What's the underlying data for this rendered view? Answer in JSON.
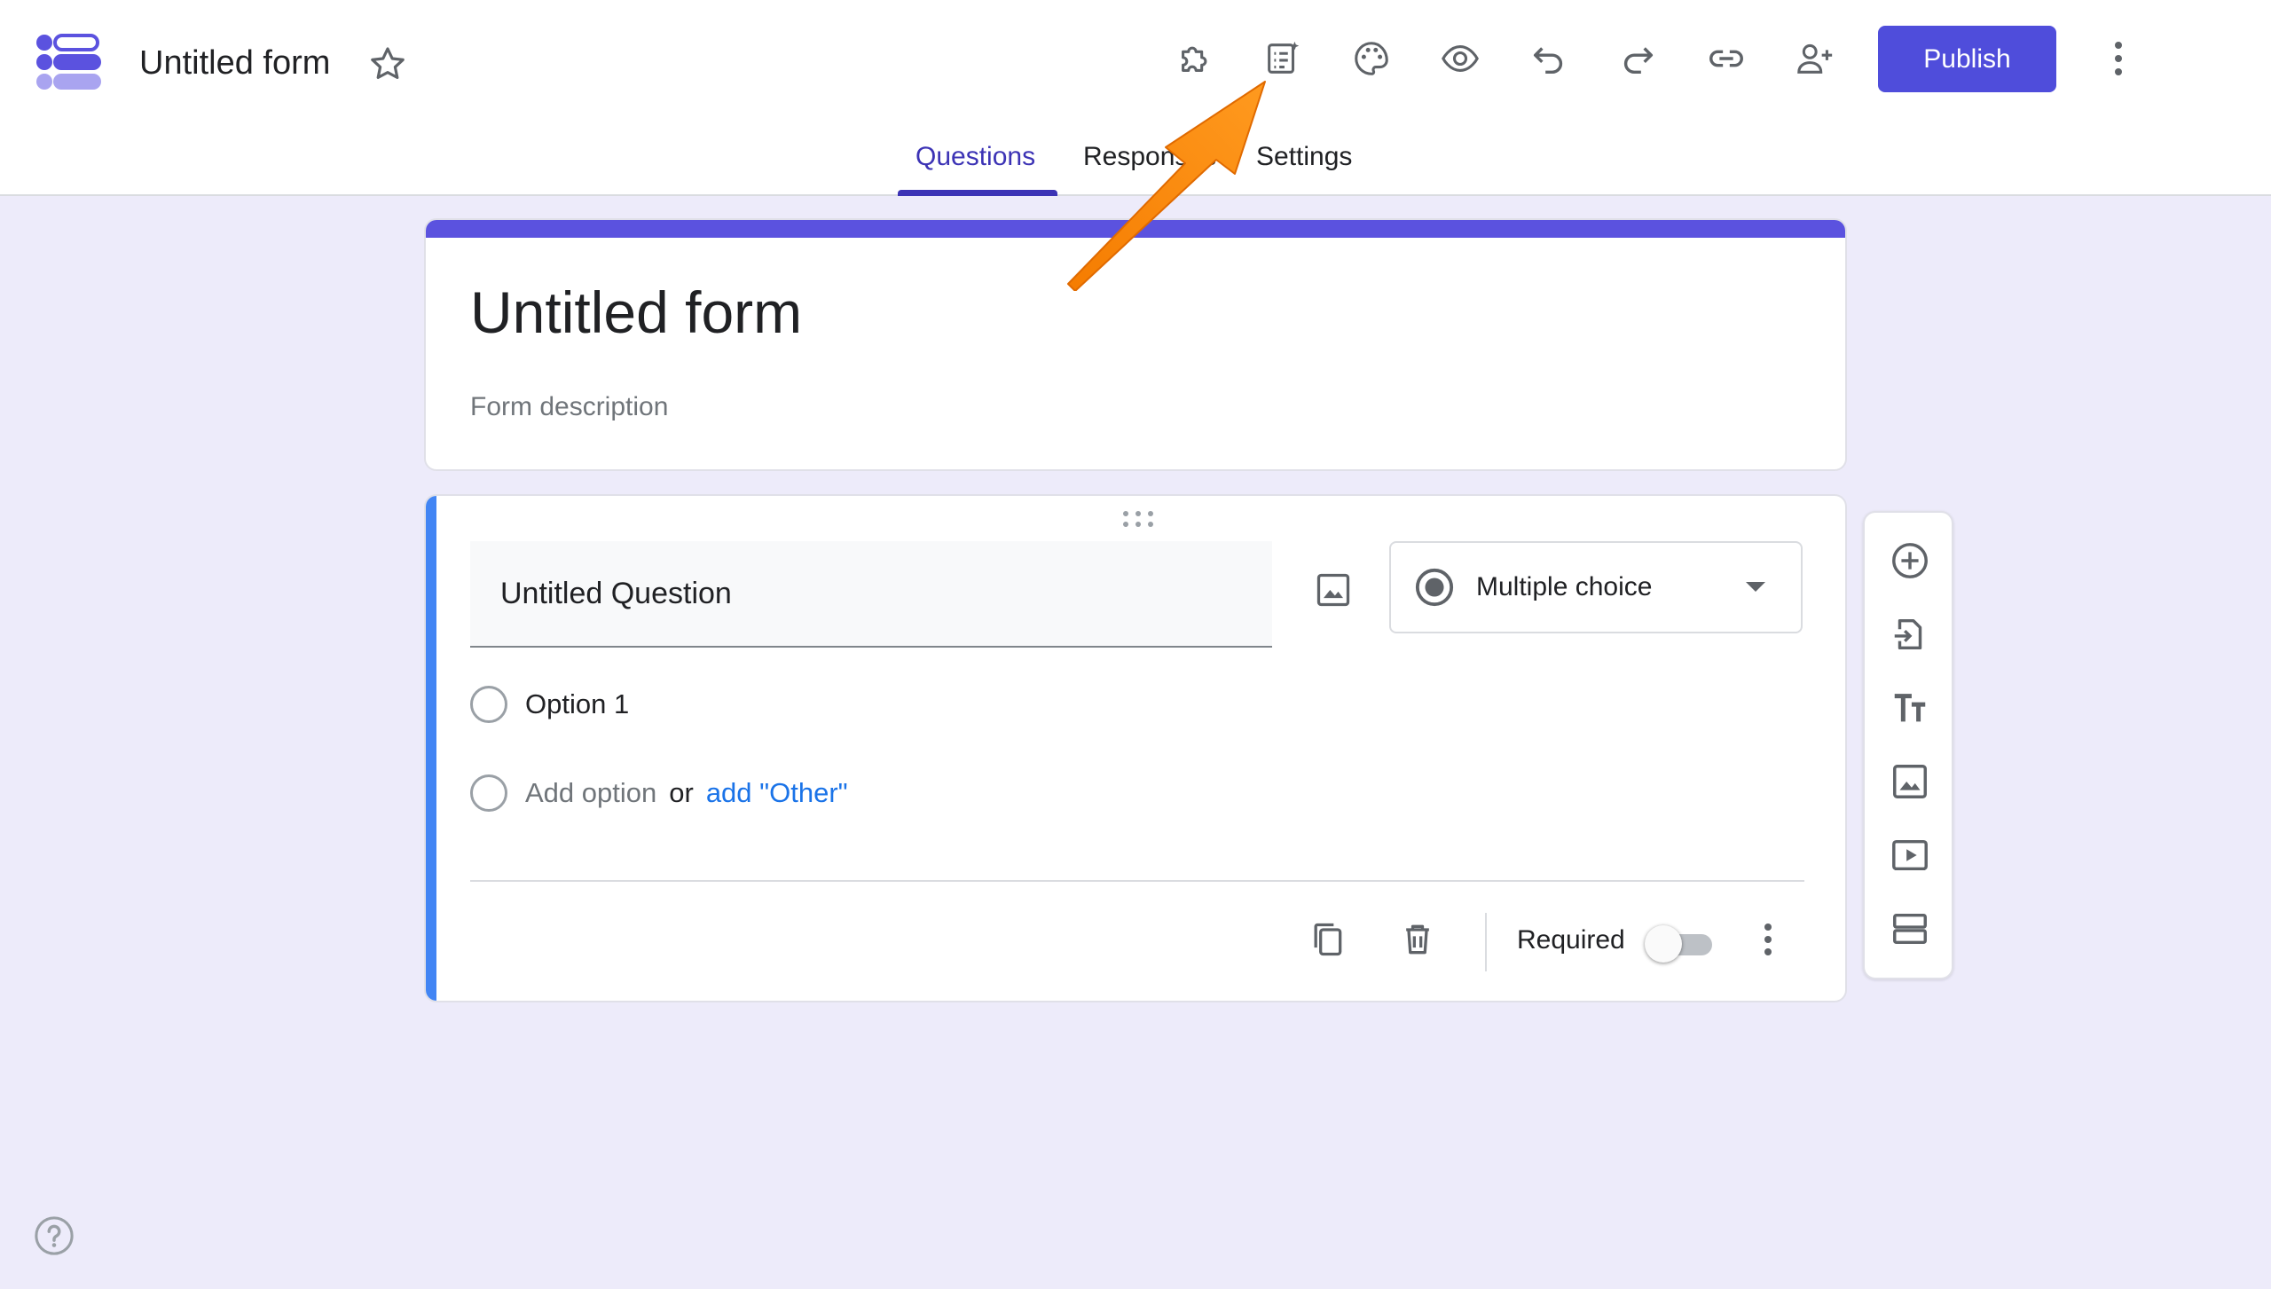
{
  "header": {
    "app_title": "Untitled form",
    "publish_label": "Publish",
    "toolbar": [
      "add-ons-icon",
      "ai-checklist-icon",
      "palette-icon",
      "preview-eye-icon",
      "undo-icon",
      "redo-icon",
      "link-icon",
      "add-collaborator-icon"
    ]
  },
  "tabs": [
    {
      "label": "Questions",
      "active": true
    },
    {
      "label": "Responses",
      "active": false
    },
    {
      "label": "Settings",
      "active": false
    }
  ],
  "form": {
    "title": "Untitled form",
    "description": "Form description"
  },
  "question": {
    "title": "Untitled Question",
    "type": "Multiple choice",
    "options": [
      "Option 1"
    ],
    "add_option": "Add option",
    "or": "or",
    "add_other": "add \"Other\"",
    "required_label": "Required",
    "required": false
  },
  "side_toolbar": [
    "add-question-icon",
    "import-questions-icon",
    "title-text-icon",
    "add-image-icon",
    "add-video-icon",
    "add-section-icon"
  ],
  "colors": {
    "accent": "#4f4ddb",
    "tab_active": "#3c33b5",
    "question_accent": "#4285f4",
    "background": "#edebfa",
    "annotation_arrow": "#f57c00"
  }
}
